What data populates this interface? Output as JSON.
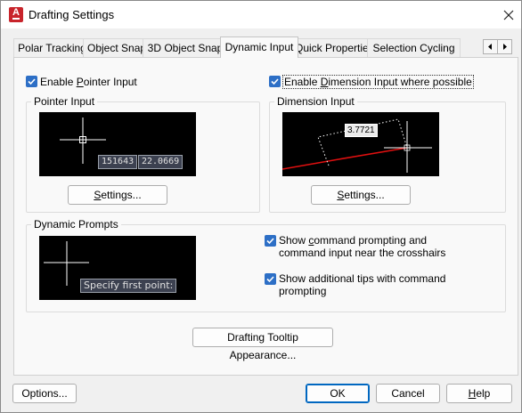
{
  "window": {
    "title": "Drafting Settings",
    "app_icon_letter": "A"
  },
  "tabs": [
    {
      "label": "Polar Tracking"
    },
    {
      "label": "Object Snap"
    },
    {
      "label": "3D Object Snap"
    },
    {
      "label": "Dynamic Input",
      "active": true
    },
    {
      "label": "Quick Properties"
    },
    {
      "label": "Selection Cycling"
    }
  ],
  "tab_scroll": {
    "left": "◂",
    "right": "▸"
  },
  "enable_pointer": {
    "pre": "Enable ",
    "ul": "P",
    "post": "ointer Input",
    "checked": true
  },
  "enable_dimension": {
    "pre": "Enable ",
    "ul": "D",
    "post": "imension Input where possible",
    "checked": true
  },
  "pointer_group": {
    "title": "Pointer Input",
    "coord_x": "151643",
    "coord_y": "22.0669",
    "settings": {
      "pre": "",
      "ul": "S",
      "post": "ettings..."
    }
  },
  "dimension_group": {
    "title": "Dimension Input",
    "value": "3.7721",
    "settings": {
      "pre": "",
      "ul": "S",
      "post": "ettings..."
    }
  },
  "prompts_group": {
    "title": "Dynamic Prompts",
    "prompt_text": "Specify first point:",
    "show_command": {
      "pre": "Show ",
      "ul": "c",
      "post": "ommand prompting and",
      "line2": "command input near the crosshairs",
      "checked": true
    },
    "show_tips": {
      "pre": "Show additional tips with command",
      "line2": "prompting",
      "checked": true
    }
  },
  "tooltip_button": "Drafting Tooltip Appearance...",
  "footer": {
    "options": "Options...",
    "ok": "OK",
    "cancel": "Cancel",
    "help": {
      "pre": "",
      "ul": "H",
      "post": "elp"
    }
  },
  "colors": {
    "accent": "#2d6fc6",
    "app_icon": "#c8242b",
    "dim_line": "#e01010"
  }
}
